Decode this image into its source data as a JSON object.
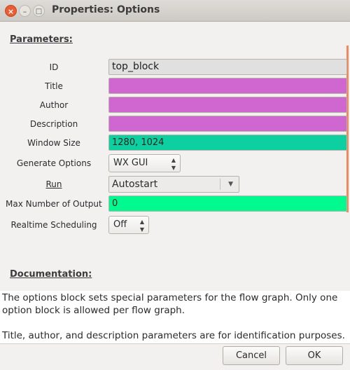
{
  "window": {
    "title": "Properties: Options",
    "close_glyph": "×",
    "minimize_glyph": "–",
    "maximize_glyph": "□"
  },
  "parameters": {
    "heading": "Parameters:",
    "fields": [
      {
        "label": "ID",
        "value": "top_block",
        "color": "#e0e0e0"
      },
      {
        "label": "Title",
        "value": "",
        "color": "#d066d0"
      },
      {
        "label": "Author",
        "value": "",
        "color": "#d066d0"
      },
      {
        "label": "Description",
        "value": "",
        "color": "#d066d0"
      },
      {
        "label": "Window Size",
        "value": "1280, 1024",
        "color": "#0cd0a0"
      },
      {
        "label": "Generate Options",
        "value": "WX GUI"
      },
      {
        "label": "Run",
        "value": "Autostart"
      },
      {
        "label": "Max Number of Output",
        "value": "0",
        "color": "#00fa90"
      },
      {
        "label": "Realtime Scheduling",
        "value": "Off"
      }
    ]
  },
  "documentation": {
    "heading": "Documentation:",
    "paragraph1": "The options block sets special parameters for the flow graph. Only one option block is allowed per flow graph.",
    "paragraph2": "Title, author, and description parameters are for identification purposes."
  },
  "buttons": {
    "cancel": "Cancel",
    "ok": "OK"
  },
  "icons": {
    "combo_arrows": "stepper-arrows-icon",
    "dropdown_arrow": "chevron-down-icon"
  }
}
